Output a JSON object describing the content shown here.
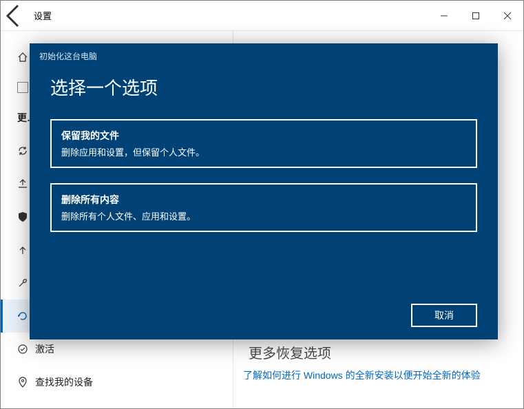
{
  "window": {
    "title": "设置"
  },
  "sidebar": {
    "items": [
      {
        "label": "主…"
      },
      {
        "label": "…"
      },
      {
        "label": "更…"
      },
      {
        "label": ""
      },
      {
        "label": ""
      },
      {
        "label": ""
      },
      {
        "label": ""
      },
      {
        "label": ""
      },
      {
        "label": ""
      },
      {
        "label": "激活"
      },
      {
        "label": "查找我的设备"
      }
    ]
  },
  "main": {
    "more_title": "更多恢复选项",
    "link_text": "了解如何进行 Windows 的全新安装以便开始全新的体验"
  },
  "dialog": {
    "small_title": "初始化这台电脑",
    "heading": "选择一个选项",
    "options": [
      {
        "title": "保留我的文件",
        "desc": "删除应用和设置，但保留个人文件。"
      },
      {
        "title": "删除所有内容",
        "desc": "删除所有个人文件、应用和设置。"
      }
    ],
    "cancel": "取消"
  }
}
